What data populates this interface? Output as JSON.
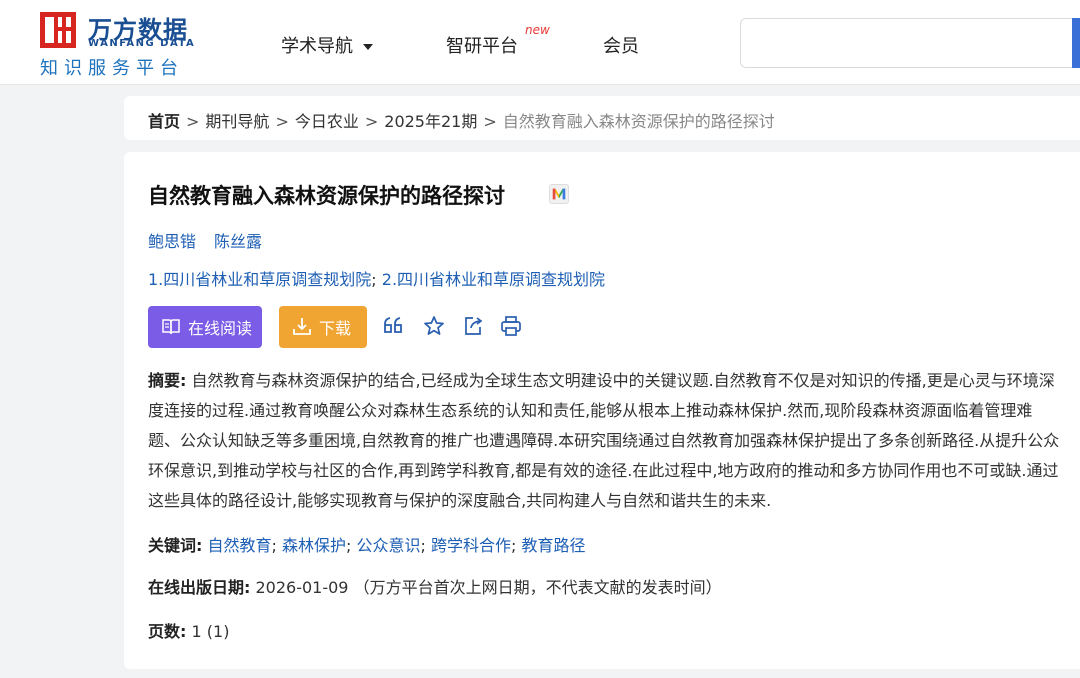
{
  "header": {
    "logo_name": "万方数据",
    "logo_en": "WANFANG DATA",
    "logo_slogan": "知识服务平台",
    "nav": {
      "academic": "学术导航",
      "zhiyan": "智研平台",
      "zhiyan_badge": "new",
      "member": "会员"
    },
    "search_placeholder": ""
  },
  "breadcrumb": {
    "home": "首页",
    "journals": "期刊导航",
    "journal": "今日农业",
    "issue": "2025年21期",
    "current": "自然教育融入森林资源保护的路径探讨",
    "separator": ">"
  },
  "article": {
    "title": "自然教育融入森林资源保护的路径探讨",
    "authors": [
      "鲍思锴",
      "陈丝露"
    ],
    "affiliations": [
      "1.四川省林业和草原调查规划院",
      "2.四川省林业和草原调查规划院"
    ],
    "affil_sep": ";",
    "read_label": "在线阅读",
    "download_label": "下载",
    "abstract_label": "摘要:",
    "abstract": "自然教育与森林资源保护的结合,已经成为全球生态文明建设中的关键议题.自然教育不仅是对知识的传播,更是心灵与环境深度连接的过程.通过教育唤醒公众对森林生态系统的认知和责任,能够从根本上推动森林保护.然而,现阶段森林资源面临着管理难题、公众认知缺乏等多重困境,自然教育的推广也遭遇障碍.本研究围绕通过自然教育加强森林保护提出了多条创新路径.从提升公众环保意识,到推动学校与社区的合作,再到跨学科教育,都是有效的途径.在此过程中,地方政府的推动和多方协同作用也不可或缺.通过这些具体的路径设计,能够实现教育与保护的深度融合,共同构建人与自然和谐共生的未来.",
    "keywords_label": "关键词:",
    "keywords": [
      "自然教育",
      "森林保护",
      "公众意识",
      "跨学科合作",
      "教育路径"
    ],
    "keyword_sep": ";",
    "date_label": "在线出版日期:",
    "date": "2026-01-09",
    "date_note": "（万方平台首次上网日期，不代表文献的发表时间）",
    "pages_label": "页数:",
    "pages": "1 (1)"
  },
  "colors": {
    "brand_red": "#d7261f",
    "brand_blue": "#1a4e93",
    "link": "#1e5fb4",
    "read_btn": "#7b5ce6",
    "download_btn": "#f0a431",
    "search_btn": "#3b6fd8"
  },
  "icons": {
    "logo": "wanfang-logo-icon",
    "caret": "caret-down-icon",
    "m_badge": "m-badge-icon",
    "read": "read-free-icon",
    "download": "download-free-icon",
    "cite": "quote-icon",
    "favorite": "star-icon",
    "share": "share-icon",
    "print": "print-icon"
  }
}
